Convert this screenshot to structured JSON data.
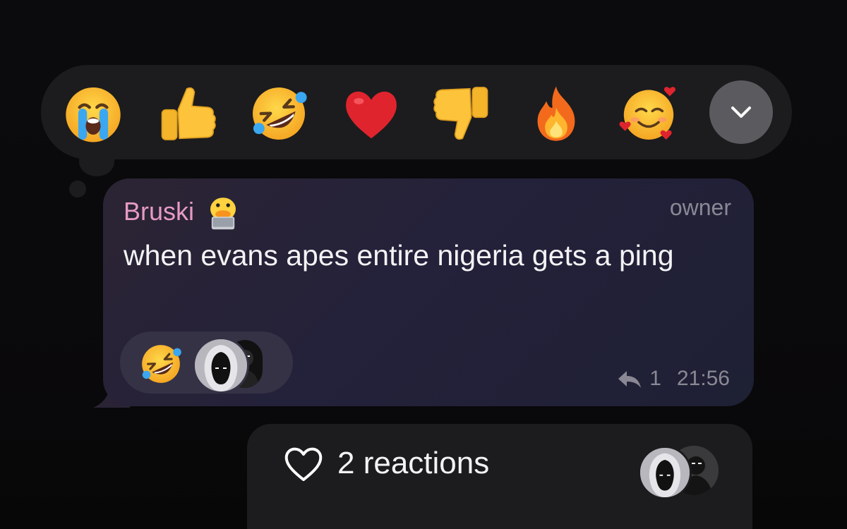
{
  "reaction_picker": {
    "emojis": [
      {
        "name": "loudly-crying-face",
        "label": "😭"
      },
      {
        "name": "thumbs-up",
        "label": "👍"
      },
      {
        "name": "rolling-on-floor-laughing",
        "label": "🤣"
      },
      {
        "name": "red-heart",
        "label": "❤️"
      },
      {
        "name": "thumbs-down",
        "label": "👎"
      },
      {
        "name": "fire",
        "label": "🔥"
      },
      {
        "name": "smiling-face-with-hearts",
        "label": "🥰"
      }
    ],
    "expand_icon": "chevron-down-icon"
  },
  "message": {
    "sender_name": "Bruski",
    "sender_badge_icon": "duck-with-laptop-icon",
    "role": "owner",
    "text": "when evans apes entire nigeria gets a ping",
    "reaction": {
      "emoji": "rolling-on-floor-laughing",
      "reactor_avatars": [
        "hooded-figure-avatar",
        "dark-figure-avatar"
      ]
    },
    "reply_icon": "reply-arrow-icon",
    "reply_count": "1",
    "time": "21:56"
  },
  "reactions_panel": {
    "icon": "heart-outline-icon",
    "label": "2 reactions",
    "avatars": [
      "hooded-figure-avatar",
      "dark-figure-avatar"
    ]
  },
  "colors": {
    "background": "#0a090b",
    "picker_bg": "#1c1c1e",
    "bubble_bg": "#26223a",
    "sender_name": "#e79ac5",
    "meta_text": "#8a8894",
    "body_text": "#f3f3f5",
    "expand_button": "#5b5b5f"
  }
}
